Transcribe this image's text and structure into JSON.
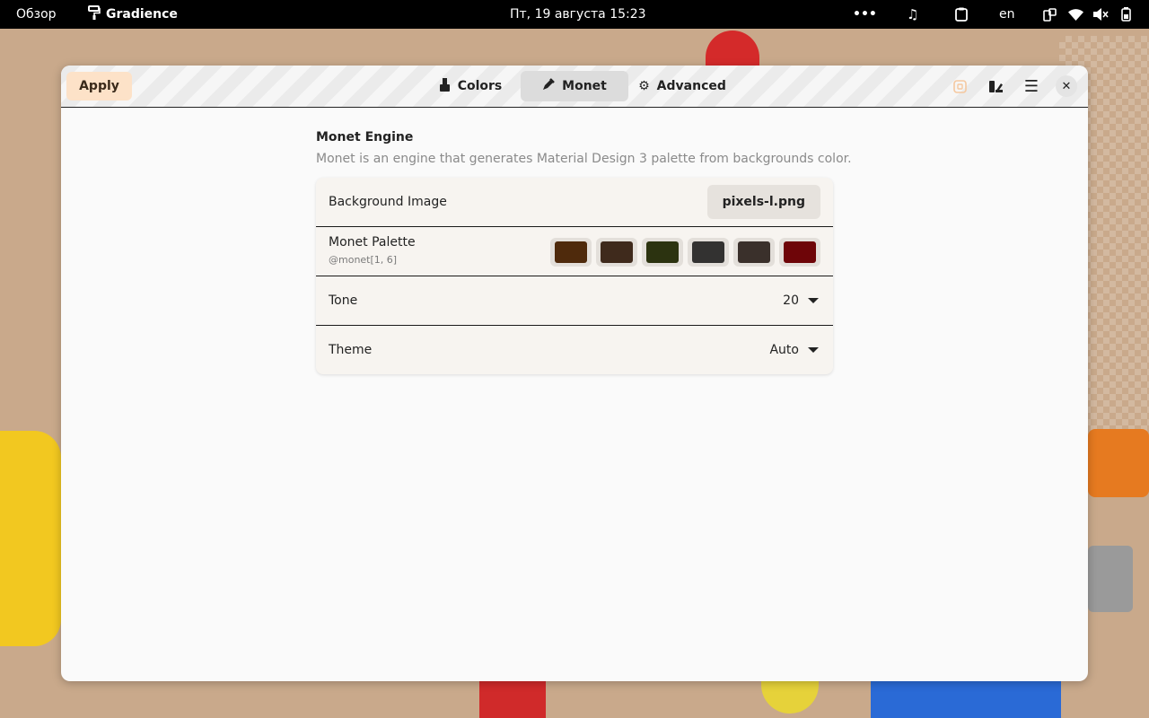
{
  "topbar": {
    "overview": "Обзор",
    "app_name": "Gradience",
    "datetime": "Пт, 19 августа  15:23",
    "more": "•••",
    "language": "en"
  },
  "window": {
    "apply_label": "Apply",
    "tabs": [
      {
        "label": "Colors",
        "icon": "brush-icon"
      },
      {
        "label": "Monet",
        "icon": "eyedropper-icon"
      },
      {
        "label": "Advanced",
        "icon": "gear-icon"
      }
    ],
    "active_tab": "Monet"
  },
  "monet": {
    "title": "Monet Engine",
    "description": "Monet is an engine that generates Material Design 3 palette from backgrounds color.",
    "background_image": {
      "label": "Background Image",
      "file": "pixels-l.png"
    },
    "palette": {
      "label": "Monet Palette",
      "subtitle": "@monet[1, 6]",
      "colors": [
        "#4f2a0c",
        "#3f2a1c",
        "#2c3310",
        "#333231",
        "#3a302b",
        "#6e0508"
      ]
    },
    "tone": {
      "label": "Tone",
      "value": "20"
    },
    "theme": {
      "label": "Theme",
      "value": "Auto"
    }
  },
  "colors": {
    "apply_bg": "#fde2c8",
    "topbar_bg": "#000000",
    "wallpaper": "#c9a98b"
  }
}
